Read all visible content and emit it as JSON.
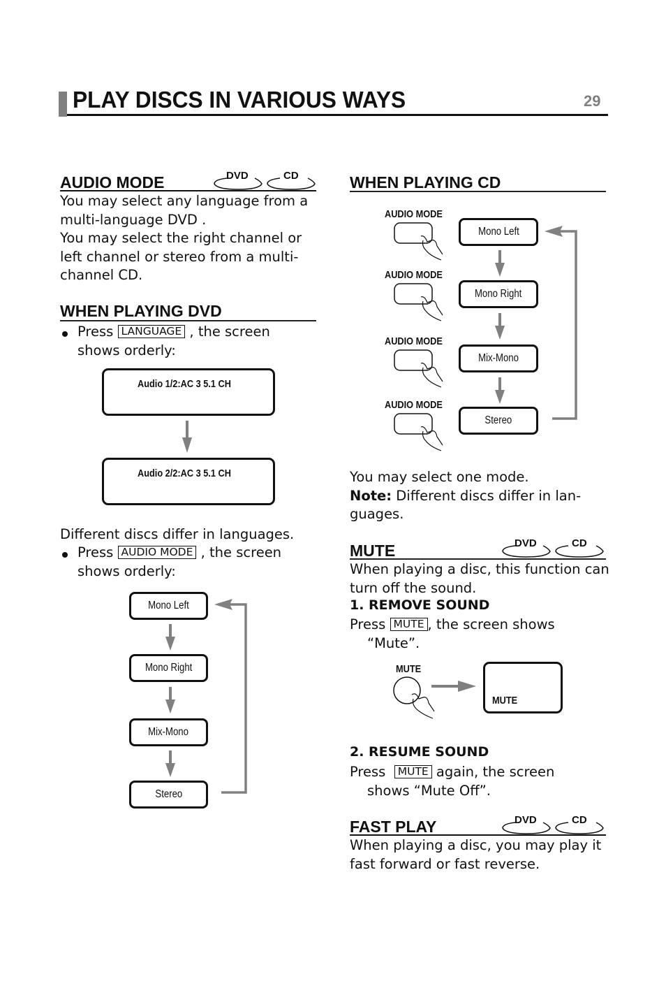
{
  "header": {
    "title": "PLAY DISCS IN VARIOUS WAYS",
    "page_number": "29"
  },
  "badges": {
    "dvd": "DVD",
    "cd": "CD"
  },
  "audio_mode": {
    "heading": "AUDIO MODE",
    "lines": [
      "You may select any language from a",
      "multi-language DVD .",
      "You may select the right channel or",
      "left channel or stereo from a multi-",
      "channel CD."
    ]
  },
  "when_playing_dvd": {
    "heading": "WHEN PLAYING DVD",
    "step1": {
      "press": "Press",
      "key": "LANGUAGE",
      "after": ", the screen",
      "line2": "shows orderly:"
    },
    "screens": [
      "Audio 1/2:AC 3 5.1 CH",
      "Audio 2/2:AC 3 5.1 CH"
    ],
    "note": "Different discs differ in languages.",
    "step2": {
      "press": "Press",
      "key": "AUDIO MODE",
      "after": ", the screen",
      "line2": "shows orderly:"
    },
    "modes": [
      "Mono Left",
      "Mono Right",
      "Mix-Mono",
      "Stereo"
    ]
  },
  "when_playing_cd": {
    "heading": "WHEN PLAYING CD",
    "button_label": "AUDIO MODE",
    "modes": [
      "Mono Left",
      "Mono Right",
      "Mix-Mono",
      "Stereo"
    ],
    "line1": "You may select one mode.",
    "note_label": "Note:",
    "note_text": " Different discs differ in lan-",
    "note_line2": "guages."
  },
  "mute": {
    "heading": "MUTE",
    "lines": [
      "When playing a disc, this function can",
      "turn off the sound."
    ],
    "remove": {
      "heading": "1. REMOVE SOUND",
      "press": "Press",
      "key": "MUTE",
      "after": ", the screen shows",
      "line2": "“Mute”.",
      "button_label": "MUTE",
      "screen_text": "MUTE"
    },
    "resume": {
      "heading": "2. RESUME SOUND",
      "press": "Press",
      "key": "MUTE",
      "after": " again, the screen",
      "line2": "shows “Mute Off”."
    }
  },
  "fast_play": {
    "heading": "FAST PLAY",
    "lines": [
      "When playing a disc, you may play it",
      "fast forward or fast reverse."
    ]
  }
}
